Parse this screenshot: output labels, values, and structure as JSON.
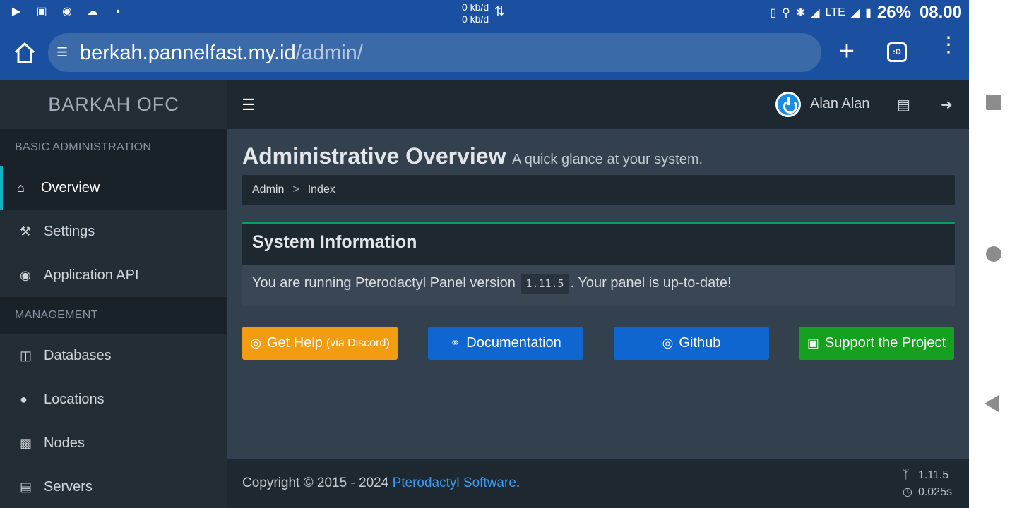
{
  "statusbar": {
    "net_up": "0 kb/d",
    "net_down": "0 kb/d",
    "network": "LTE",
    "battery": "26%",
    "clock": "08.00"
  },
  "browser": {
    "url_host": "berkah.pannelfast.my.id",
    "url_path": "/admin/",
    "tab_label": ":D"
  },
  "panel": {
    "brand": "BARKAH OFC",
    "user_name": "Alan Alan"
  },
  "sidebar": {
    "sections": [
      {
        "header": "BASIC ADMINISTRATION",
        "items": [
          {
            "label": "Overview",
            "icon": "home-icon"
          },
          {
            "label": "Settings",
            "icon": "wrench-icon"
          },
          {
            "label": "Application API",
            "icon": "gamepad-icon"
          }
        ]
      },
      {
        "header": "MANAGEMENT",
        "items": [
          {
            "label": "Databases",
            "icon": "database-icon"
          },
          {
            "label": "Locations",
            "icon": "globe-icon"
          },
          {
            "label": "Nodes",
            "icon": "sitemap-icon"
          },
          {
            "label": "Servers",
            "icon": "server-icon"
          }
        ]
      }
    ]
  },
  "content": {
    "title": "Administrative Overview",
    "subtitle": "A quick glance at your system.",
    "breadcrumb": [
      "Admin",
      "Index"
    ],
    "system_box": {
      "heading": "System Information",
      "text_before": "You are running Pterodactyl Panel version",
      "version": "1.11.5",
      "text_after": ". Your panel is up-to-date!"
    },
    "buttons": {
      "help": "Get Help",
      "help_small": "(via Discord)",
      "docs": "Documentation",
      "github": "Github",
      "support": "Support the Project"
    }
  },
  "footer": {
    "copyright": "Copyright © 2015 - 2024 ",
    "link": "Pterodactyl Software",
    "period": ".",
    "version": "1.11.5",
    "time": "0.025s"
  }
}
